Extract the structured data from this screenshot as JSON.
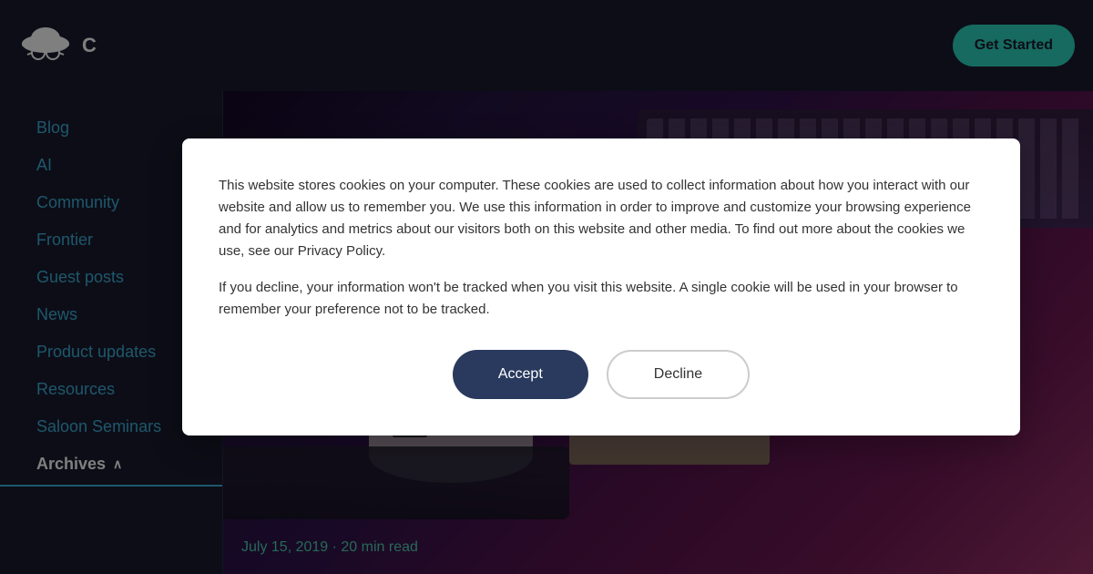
{
  "header": {
    "logo_text": "C",
    "get_started_label": "Get Started"
  },
  "sidebar": {
    "items": [
      {
        "id": "blog",
        "label": "Blog"
      },
      {
        "id": "ai",
        "label": "AI"
      },
      {
        "id": "community",
        "label": "Community"
      },
      {
        "id": "frontier",
        "label": "Frontier"
      },
      {
        "id": "guest-posts",
        "label": "Guest posts"
      },
      {
        "id": "news",
        "label": "News"
      },
      {
        "id": "product-updates",
        "label": "Product updates"
      },
      {
        "id": "resources",
        "label": "Resources"
      },
      {
        "id": "saloon-seminars",
        "label": "Saloon Seminars"
      },
      {
        "id": "archives",
        "label": "Archives"
      }
    ]
  },
  "main": {
    "article_date": "July 15, 2019",
    "article_read_time": "20 min read",
    "article_meta": "July 15, 2019 · 20 min read"
  },
  "cookie_modal": {
    "text1": "This website stores cookies on your computer. These cookies are used to collect information about how you interact with our website and allow us to remember you. We use this information in order to improve and customize your browsing experience and for analytics and metrics about our visitors both on this website and other media. To find out more about the cookies we use, see our Privacy Policy.",
    "text2": "If you decline, your information won't be tracked when you visit this website. A single cookie will be used in your browser to remember your preference not to be tracked.",
    "accept_label": "Accept",
    "decline_label": "Decline"
  }
}
